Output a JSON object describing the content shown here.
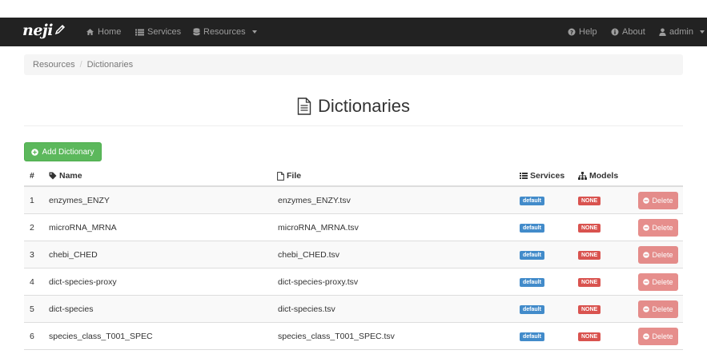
{
  "navbar": {
    "brand": "neji",
    "items": [
      {
        "label": "Home",
        "icon": "home-icon"
      },
      {
        "label": "Services",
        "icon": "list-icon"
      },
      {
        "label": "Resources",
        "icon": "database-icon"
      }
    ],
    "right_items": [
      {
        "label": "Help",
        "icon": "question-circle-icon"
      },
      {
        "label": "About",
        "icon": "info-circle-icon"
      },
      {
        "label": "admin",
        "icon": "user-icon"
      }
    ]
  },
  "breadcrumb": {
    "parent": "Resources",
    "separator": "/",
    "current": "Dictionaries"
  },
  "page": {
    "title": "Dictionaries",
    "add_button": "Add Dictionary"
  },
  "table": {
    "headers": {
      "num": "#",
      "name": "Name",
      "file": "File",
      "services": "Services",
      "models": "Models"
    },
    "rows": [
      {
        "num": "1",
        "name": "enzymes_ENZY",
        "file": "enzymes_ENZY.tsv",
        "service": "default",
        "model": "NONE",
        "action": "Delete"
      },
      {
        "num": "2",
        "name": "microRNA_MRNA",
        "file": "microRNA_MRNA.tsv",
        "service": "default",
        "model": "NONE",
        "action": "Delete"
      },
      {
        "num": "3",
        "name": "chebi_CHED",
        "file": "chebi_CHED.tsv",
        "service": "default",
        "model": "NONE",
        "action": "Delete"
      },
      {
        "num": "4",
        "name": "dict-species-proxy",
        "file": "dict-species-proxy.tsv",
        "service": "default",
        "model": "NONE",
        "action": "Delete"
      },
      {
        "num": "5",
        "name": "dict-species",
        "file": "dict-species.tsv",
        "service": "default",
        "model": "NONE",
        "action": "Delete"
      },
      {
        "num": "6",
        "name": "species_class_T001_SPEC",
        "file": "species_class_T001_SPEC.tsv",
        "service": "default",
        "model": "NONE",
        "action": "Delete"
      }
    ]
  },
  "colors": {
    "navbar_bg": "#222222",
    "success": "#5cb85c",
    "primary": "#428bca",
    "danger": "#d9534f"
  }
}
